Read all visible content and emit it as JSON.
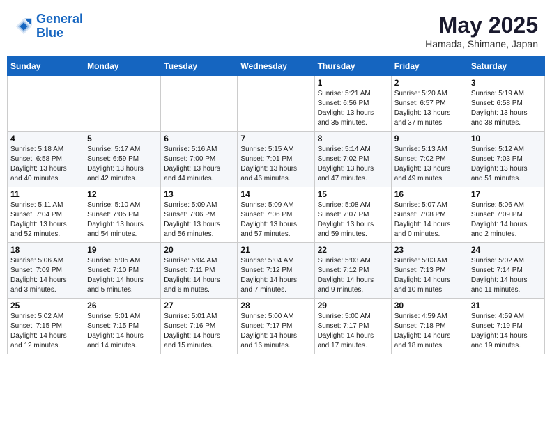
{
  "header": {
    "logo_line1": "General",
    "logo_line2": "Blue",
    "month": "May 2025",
    "location": "Hamada, Shimane, Japan"
  },
  "weekdays": [
    "Sunday",
    "Monday",
    "Tuesday",
    "Wednesday",
    "Thursday",
    "Friday",
    "Saturday"
  ],
  "weeks": [
    [
      {
        "day": "",
        "info": ""
      },
      {
        "day": "",
        "info": ""
      },
      {
        "day": "",
        "info": ""
      },
      {
        "day": "",
        "info": ""
      },
      {
        "day": "1",
        "info": "Sunrise: 5:21 AM\nSunset: 6:56 PM\nDaylight: 13 hours\nand 35 minutes."
      },
      {
        "day": "2",
        "info": "Sunrise: 5:20 AM\nSunset: 6:57 PM\nDaylight: 13 hours\nand 37 minutes."
      },
      {
        "day": "3",
        "info": "Sunrise: 5:19 AM\nSunset: 6:58 PM\nDaylight: 13 hours\nand 38 minutes."
      }
    ],
    [
      {
        "day": "4",
        "info": "Sunrise: 5:18 AM\nSunset: 6:58 PM\nDaylight: 13 hours\nand 40 minutes."
      },
      {
        "day": "5",
        "info": "Sunrise: 5:17 AM\nSunset: 6:59 PM\nDaylight: 13 hours\nand 42 minutes."
      },
      {
        "day": "6",
        "info": "Sunrise: 5:16 AM\nSunset: 7:00 PM\nDaylight: 13 hours\nand 44 minutes."
      },
      {
        "day": "7",
        "info": "Sunrise: 5:15 AM\nSunset: 7:01 PM\nDaylight: 13 hours\nand 46 minutes."
      },
      {
        "day": "8",
        "info": "Sunrise: 5:14 AM\nSunset: 7:02 PM\nDaylight: 13 hours\nand 47 minutes."
      },
      {
        "day": "9",
        "info": "Sunrise: 5:13 AM\nSunset: 7:02 PM\nDaylight: 13 hours\nand 49 minutes."
      },
      {
        "day": "10",
        "info": "Sunrise: 5:12 AM\nSunset: 7:03 PM\nDaylight: 13 hours\nand 51 minutes."
      }
    ],
    [
      {
        "day": "11",
        "info": "Sunrise: 5:11 AM\nSunset: 7:04 PM\nDaylight: 13 hours\nand 52 minutes."
      },
      {
        "day": "12",
        "info": "Sunrise: 5:10 AM\nSunset: 7:05 PM\nDaylight: 13 hours\nand 54 minutes."
      },
      {
        "day": "13",
        "info": "Sunrise: 5:09 AM\nSunset: 7:06 PM\nDaylight: 13 hours\nand 56 minutes."
      },
      {
        "day": "14",
        "info": "Sunrise: 5:09 AM\nSunset: 7:06 PM\nDaylight: 13 hours\nand 57 minutes."
      },
      {
        "day": "15",
        "info": "Sunrise: 5:08 AM\nSunset: 7:07 PM\nDaylight: 13 hours\nand 59 minutes."
      },
      {
        "day": "16",
        "info": "Sunrise: 5:07 AM\nSunset: 7:08 PM\nDaylight: 14 hours\nand 0 minutes."
      },
      {
        "day": "17",
        "info": "Sunrise: 5:06 AM\nSunset: 7:09 PM\nDaylight: 14 hours\nand 2 minutes."
      }
    ],
    [
      {
        "day": "18",
        "info": "Sunrise: 5:06 AM\nSunset: 7:09 PM\nDaylight: 14 hours\nand 3 minutes."
      },
      {
        "day": "19",
        "info": "Sunrise: 5:05 AM\nSunset: 7:10 PM\nDaylight: 14 hours\nand 5 minutes."
      },
      {
        "day": "20",
        "info": "Sunrise: 5:04 AM\nSunset: 7:11 PM\nDaylight: 14 hours\nand 6 minutes."
      },
      {
        "day": "21",
        "info": "Sunrise: 5:04 AM\nSunset: 7:12 PM\nDaylight: 14 hours\nand 7 minutes."
      },
      {
        "day": "22",
        "info": "Sunrise: 5:03 AM\nSunset: 7:12 PM\nDaylight: 14 hours\nand 9 minutes."
      },
      {
        "day": "23",
        "info": "Sunrise: 5:03 AM\nSunset: 7:13 PM\nDaylight: 14 hours\nand 10 minutes."
      },
      {
        "day": "24",
        "info": "Sunrise: 5:02 AM\nSunset: 7:14 PM\nDaylight: 14 hours\nand 11 minutes."
      }
    ],
    [
      {
        "day": "25",
        "info": "Sunrise: 5:02 AM\nSunset: 7:15 PM\nDaylight: 14 hours\nand 12 minutes."
      },
      {
        "day": "26",
        "info": "Sunrise: 5:01 AM\nSunset: 7:15 PM\nDaylight: 14 hours\nand 14 minutes."
      },
      {
        "day": "27",
        "info": "Sunrise: 5:01 AM\nSunset: 7:16 PM\nDaylight: 14 hours\nand 15 minutes."
      },
      {
        "day": "28",
        "info": "Sunrise: 5:00 AM\nSunset: 7:17 PM\nDaylight: 14 hours\nand 16 minutes."
      },
      {
        "day": "29",
        "info": "Sunrise: 5:00 AM\nSunset: 7:17 PM\nDaylight: 14 hours\nand 17 minutes."
      },
      {
        "day": "30",
        "info": "Sunrise: 4:59 AM\nSunset: 7:18 PM\nDaylight: 14 hours\nand 18 minutes."
      },
      {
        "day": "31",
        "info": "Sunrise: 4:59 AM\nSunset: 7:19 PM\nDaylight: 14 hours\nand 19 minutes."
      }
    ]
  ]
}
